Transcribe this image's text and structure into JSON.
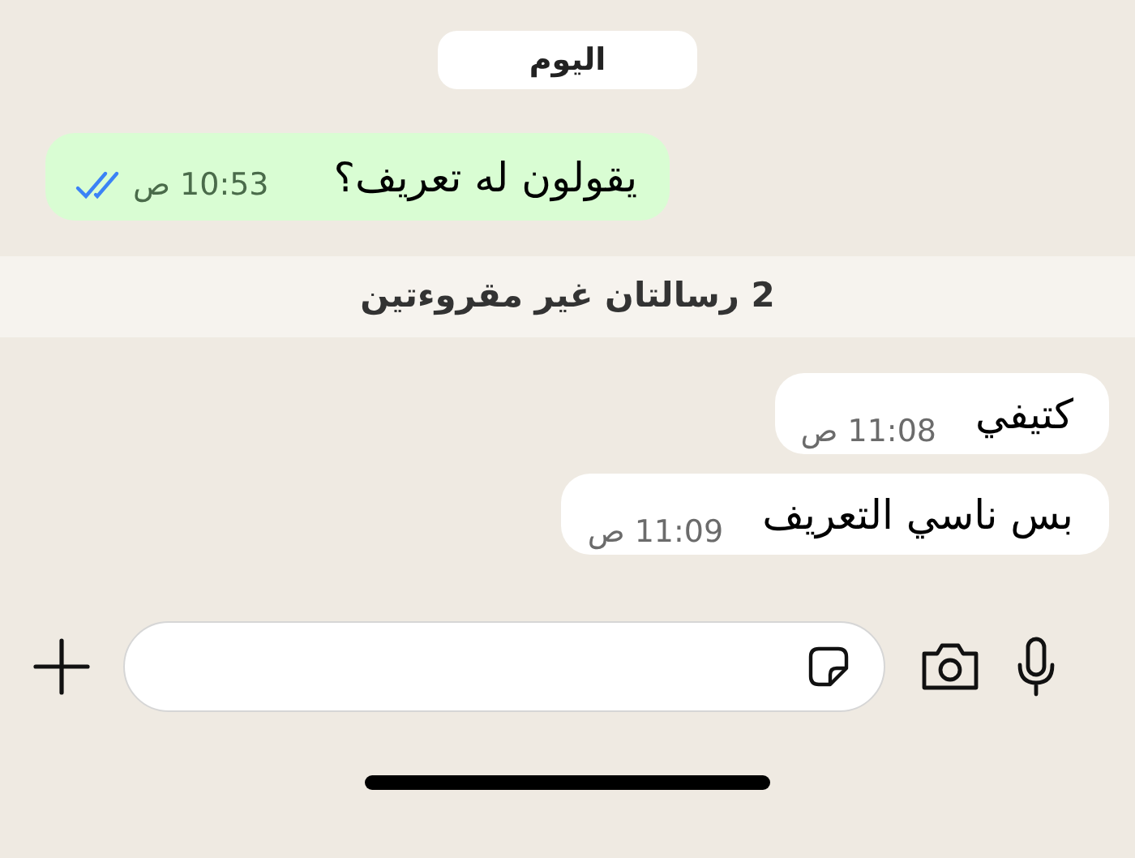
{
  "date_label": "اليوم",
  "messages": [
    {
      "kind": "outgoing",
      "text": "يقولون له تعريف؟",
      "time": "10:53 ص",
      "read": true
    }
  ],
  "unread_banner": "2 رسالتان غير مقروءتين",
  "messages_after": [
    {
      "kind": "incoming",
      "text": "كتيفي",
      "time": "11:08 ص"
    },
    {
      "kind": "incoming",
      "text": "بس ناسي التعريف",
      "time": "11:09 ص"
    }
  ]
}
